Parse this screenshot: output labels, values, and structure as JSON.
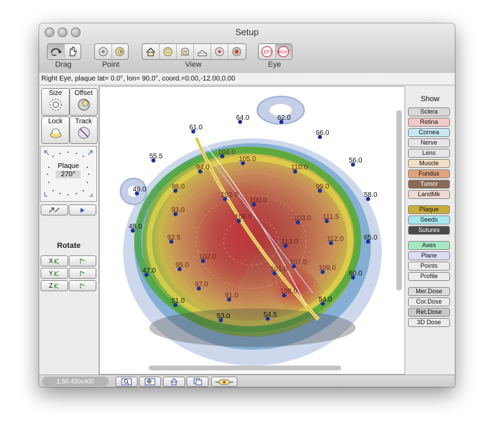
{
  "window": {
    "title": "Setup"
  },
  "toolbar": {
    "groups": [
      {
        "label": "Drag",
        "buttons": [
          "rotate-drag-icon",
          "hand-drag-icon"
        ]
      },
      {
        "label": "Point",
        "buttons": [
          "point-eye-icon",
          "point-target-icon"
        ]
      },
      {
        "label": "View",
        "buttons": [
          "view-home-icon",
          "view-top-icon",
          "view-side-icon",
          "view-bottom-icon",
          "view-front-icon",
          "view-back-icon"
        ]
      },
      {
        "label": "Eye",
        "buttons": [
          "LEFT",
          "RIGHT"
        ]
      }
    ]
  },
  "status": {
    "text": "Right Eye, plaque lat=  0.0°, lon= 90.0°, coord.=0.00,-12.00,0.00"
  },
  "left_panel": {
    "size_label": "Size",
    "offset_label": "Offset",
    "lock_label": "Lock",
    "track_label": "Track",
    "plaque_label": "Plaque",
    "plaque_angle": "270°",
    "rotate_label": "Rotate",
    "axes": [
      "X",
      "Y",
      "Z"
    ]
  },
  "show_panel": {
    "title": "Show",
    "items": [
      {
        "label": "Sclera",
        "color": "#d9d9d9"
      },
      {
        "label": "Retina",
        "color": "#f2c9c9"
      },
      {
        "label": "Cornea",
        "color": "#c9e6f4"
      },
      {
        "label": "Nerve",
        "color": "#e6e6e6"
      },
      {
        "label": "Lens",
        "color": "#e6e6e6"
      },
      {
        "label": "Muscle",
        "color": "#f3dfc6"
      },
      {
        "label": "Fundus",
        "color": "#dfa27c"
      },
      {
        "label": "Tumor",
        "color": "#8a6a55"
      },
      {
        "label": "LandMk",
        "color": "#f1d9d4"
      },
      {
        "label": "Plaque",
        "color": "#c8ad3a"
      },
      {
        "label": "Seeds",
        "color": "#a6e7ef"
      },
      {
        "label": "Sutures",
        "color": "#4a4a4a"
      },
      {
        "label": "Axes",
        "color": "#a4e8c2"
      },
      {
        "label": "Plane",
        "color": "#dcdcf7"
      },
      {
        "label": "Points",
        "color": "#ececec"
      },
      {
        "label": "Profile",
        "color": "#ececec"
      },
      {
        "label": "Mer.Dose",
        "color": "#dcdcdc"
      },
      {
        "label": "Cor.Dose",
        "color": "#ececec"
      },
      {
        "label": "Ret.Dose",
        "color": "#c9c9c9"
      },
      {
        "label": "3D Dose",
        "color": "#ececec"
      }
    ]
  },
  "bottom_bar": {
    "zoom_label": "1.50 430x400"
  },
  "dose_labels": [
    "64.0",
    "61.0",
    "62.0",
    "66.0",
    "55.5",
    "56.0",
    "49.0",
    "58.0",
    "48.0",
    "65.0",
    "47.0",
    "60.0",
    "51.0",
    "53.0",
    "54.5",
    "54.0",
    "94.0",
    "104.0",
    "105.0",
    "98.0",
    "110.0",
    "99.0",
    "102.0",
    "111.5",
    "100.0",
    "93.0",
    "112.0",
    "92.5",
    "113.0",
    "103.0",
    "106.0",
    "107.0",
    "91.0",
    "97.0",
    "102.0",
    "95.0",
    "101.0",
    "108.0",
    "109.0"
  ]
}
